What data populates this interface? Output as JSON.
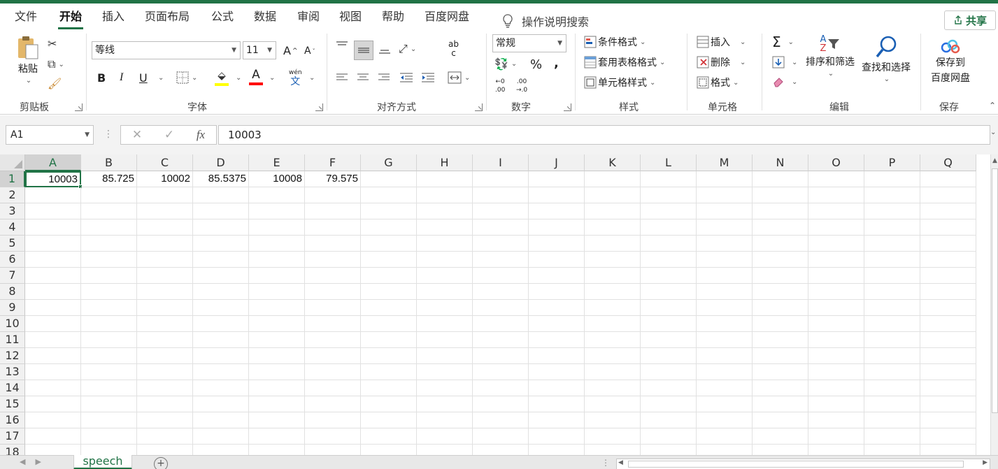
{
  "tabs": [
    "文件",
    "开始",
    "插入",
    "页面布局",
    "公式",
    "数据",
    "审阅",
    "视图",
    "帮助",
    "百度网盘"
  ],
  "active_tab": "开始",
  "tell_me": "操作说明搜索",
  "share": "共享",
  "ribbon": {
    "clipboard": {
      "label": "剪贴板",
      "paste": "粘贴"
    },
    "font": {
      "label": "字体",
      "name": "等线",
      "size": "11",
      "grow": "A",
      "shrink": "A",
      "bold": "B",
      "italic": "I",
      "underline": "U",
      "font_color": "A",
      "phonetic_top": "wén",
      "phonetic_bottom": "文"
    },
    "alignment": {
      "label": "对齐方式",
      "wrap_top": "ab",
      "wrap_bottom": "c"
    },
    "number": {
      "label": "数字",
      "format": "常规",
      "percent": "%",
      "comma": ",",
      "inc_top": "←0",
      "inc_bottom": ".00",
      "dec_top": ".00",
      "dec_bottom": "→.0"
    },
    "styles": {
      "label": "样式",
      "conditional": "条件格式",
      "table": "套用表格格式",
      "cell_styles": "单元格样式"
    },
    "cells": {
      "label": "单元格",
      "insert": "插入",
      "delete": "删除",
      "format": "格式"
    },
    "editing": {
      "label": "编辑",
      "sigma": "Σ",
      "sort_top": "A",
      "sort_bottom": "Z",
      "sort_filter": "排序和筛选",
      "find": "查找和选择"
    },
    "save": {
      "label": "保存",
      "line1": "保存到",
      "line2": "百度网盘"
    }
  },
  "formula_bar": {
    "name_box": "A1",
    "fx": "fx",
    "value": "10003"
  },
  "columns": [
    "A",
    "B",
    "C",
    "D",
    "E",
    "F",
    "G",
    "H",
    "I",
    "J",
    "K",
    "L",
    "M",
    "N",
    "O",
    "P",
    "Q"
  ],
  "rows": [
    "1",
    "2",
    "3",
    "4",
    "5",
    "6",
    "7",
    "8",
    "9",
    "10",
    "11",
    "12",
    "13",
    "14",
    "15",
    "16",
    "17",
    "18"
  ],
  "cells": [
    {
      "ref": "A1",
      "value": "10003"
    },
    {
      "ref": "B1",
      "value": "85.725"
    },
    {
      "ref": "C1",
      "value": "10002"
    },
    {
      "ref": "D1",
      "value": "85.5375"
    },
    {
      "ref": "E1",
      "value": "10008"
    },
    {
      "ref": "F1",
      "value": "79.575"
    }
  ],
  "selected_cell": "A1",
  "sheet": {
    "name": "speech",
    "add": "+"
  },
  "colors": {
    "accent": "#217346",
    "highlight": "#ffff00",
    "font_color": "#ff0000"
  }
}
